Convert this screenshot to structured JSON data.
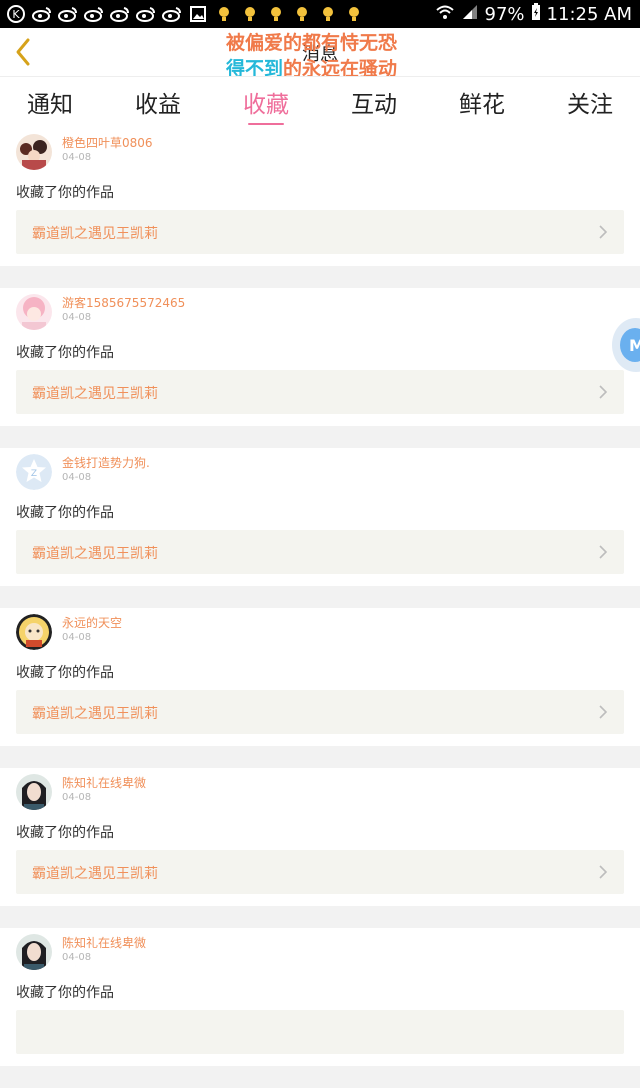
{
  "status_bar": {
    "battery_text": "97%",
    "time": "11:25 AM",
    "left_icons": [
      "k-circle-icon",
      "weibo-icon",
      "weibo-icon",
      "weibo-icon",
      "weibo-icon",
      "weibo-icon",
      "weibo-icon",
      "image-icon",
      "bulb-icon",
      "bulb-icon",
      "bulb-icon",
      "bulb-icon",
      "bulb-icon",
      "bulb-icon"
    ]
  },
  "header": {
    "title": "消息",
    "overlay_line1": "被偏爱的都有恃无恐",
    "overlay_line2_a": "得不到",
    "overlay_line2_b": "的永远在骚动"
  },
  "tabs": [
    {
      "label": "通知",
      "active": false
    },
    {
      "label": "收益",
      "active": false
    },
    {
      "label": "收藏",
      "active": true
    },
    {
      "label": "互动",
      "active": false
    },
    {
      "label": "鲜花",
      "active": false
    },
    {
      "label": "关注",
      "active": false
    }
  ],
  "notifications": [
    {
      "username": "橙色四叶草0806",
      "date": "04-08",
      "action": "收藏了你的作品",
      "work_title": "霸道凯之遇见王凯莉"
    },
    {
      "username": "游客1585675572465",
      "date": "04-08",
      "action": "收藏了你的作品",
      "work_title": "霸道凯之遇见王凯莉"
    },
    {
      "username": "金钱打造势力狗.",
      "date": "04-08",
      "action": "收藏了你的作品",
      "work_title": "霸道凯之遇见王凯莉"
    },
    {
      "username": "永远的天空",
      "date": "04-08",
      "action": "收藏了你的作品",
      "work_title": "霸道凯之遇见王凯莉"
    },
    {
      "username": "陈知礼在线卑微",
      "date": "04-08",
      "action": "收藏了你的作品",
      "work_title": "霸道凯之遇见王凯莉"
    },
    {
      "username": "陈知礼在线卑微",
      "date": "04-08",
      "action": "收藏了你的作品",
      "work_title": ""
    }
  ],
  "float_button_letter": "M",
  "colors": {
    "accent_pink": "#ef6e9b",
    "username_orange": "#f0905a",
    "overlay_orange": "#f07a4a",
    "overlay_cyan": "#24b8d9"
  }
}
